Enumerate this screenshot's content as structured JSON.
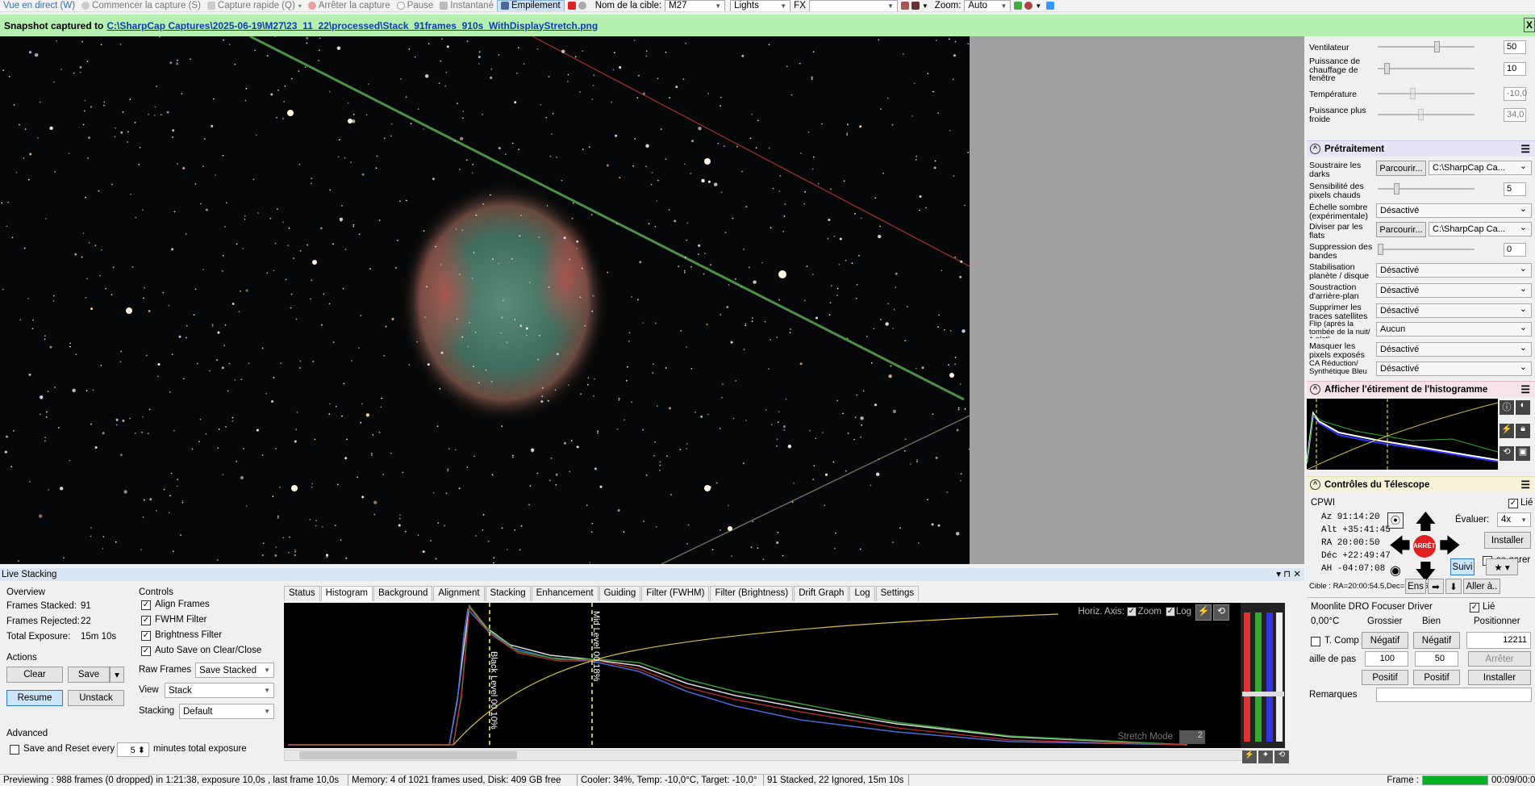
{
  "toolbar": {
    "live": "Vue en direct (W)",
    "start_capture": "Commencer la capture (S)",
    "quick_capture": "Capture rapide (Q)",
    "stop_capture": "Arrêter la capture",
    "pause": "Pause",
    "snapshot": "Instantané",
    "stacking": "Empilement",
    "target_label": "Nom de la cible:",
    "target_value": "M27",
    "frame_type": "Lights",
    "fx_label": "FX",
    "zoom_label": "Zoom:",
    "zoom_value": "Auto"
  },
  "snapshot": {
    "prefix": "Snapshot captured to",
    "path": "C:\\SharpCap Captures\\2025-06-19\\M27\\23_11_22\\processed\\Stack_91frames_910s_WithDisplayStretch.png",
    "close": "X"
  },
  "live_stacking": {
    "title": "Live Stacking",
    "overview_title": "Overview",
    "frames_stacked_label": "Frames Stacked:",
    "frames_stacked": "91",
    "frames_rejected_label": "Frames Rejected:",
    "frames_rejected": "22",
    "total_exposure_label": "Total Exposure:",
    "total_exposure": "15m 10s",
    "actions_title": "Actions",
    "clear": "Clear",
    "save": "Save",
    "resume": "Resume",
    "unstack": "Unstack",
    "controls_title": "Controls",
    "align": "Align Frames",
    "fwhm": "FWHM Filter",
    "brightness": "Brightness Filter",
    "autosave": "Auto Save on Clear/Close",
    "raw_frames_label": "Raw Frames",
    "raw_frames_value": "Save Stacked",
    "view_label": "View",
    "view_value": "Stack",
    "stacking_label": "Stacking",
    "stacking_value": "Default",
    "advanced_title": "Advanced",
    "save_reset_label": "Save and Reset every",
    "save_reset_value": "5",
    "save_reset_suffix": "minutes total exposure",
    "tabs": [
      "Status",
      "Histogram",
      "Background",
      "Alignment",
      "Stacking",
      "Enhancement",
      "Guiding",
      "Filter (FWHM)",
      "Filter (Brightness)",
      "Drift Graph",
      "Log",
      "Settings"
    ],
    "active_tab": "Histogram",
    "horiz_axis_label": "Horiz. Axis:",
    "zoom_label": "Zoom",
    "log_label": "Log",
    "black_level": "Black Level 00.10%",
    "mid_level": "Mid Level 00.18%",
    "stretch_mode": "Stretch Mode",
    "stretch_value": "2"
  },
  "status_bar": {
    "preview": "Previewing : 988 frames (0 dropped) in 1:21:38, exposure 10,0s , last frame 10,0s",
    "memory": "Memory: 4 of 1021 frames used, Disk: 409 GB free",
    "cooler": "Cooler: 34%, Temp: -10,0°C, Target: -10,0°",
    "stack": "91 Stacked, 22 Ignored, 15m 10s",
    "frame_label": "Frame :",
    "time": "00:09/00:0",
    "frame_progress": 1.0
  },
  "right_panel": {
    "fan_label": "Ventilateur",
    "fan_value": "50",
    "heater_label": "Puissance de chauffage de fenêtre",
    "heater_value": "10",
    "temp_label": "Température",
    "temp_value": "-10,0",
    "cooler_label": "Puissance plus froide",
    "cooler_value": "34,0",
    "preproc_title": "Prétraitement",
    "darks_label": "Soustraire les darks",
    "browse": "Parcourir...",
    "darks_path": "C:\\SharpCap Ca...",
    "hotpix_label": "Sensibilité des pixels chauds",
    "hotpix_value": "5",
    "dark_scale_label": "Échelle sombre (expérimentale)",
    "dark_scale_value": "Désactivé",
    "flats_label": "Diviser par les flats",
    "flats_path": "C:\\SharpCap Ca...",
    "banding_label": "Suppression des bandes",
    "banding_value": "0",
    "stab_label": "Stabilisation planète / disque",
    "stab_value": "Désactivé",
    "bg_label": "Soustraction d'arrière-plan",
    "bg_value": "Désactivé",
    "sat_label": "Supprimer les traces satellites",
    "sat_value": "Désactivé",
    "flip_label": "Flip (après la tombée de la nuit/à plat)",
    "flip_value": "Aucun",
    "mask_label": "Masquer les pixels exposés",
    "mask_value": "Désactivé",
    "ca_label": "CA Réduction/ Synthétique Bleu",
    "ca_value": "Désactivé",
    "hist_title": "Afficher l'étirement de l'histogramme",
    "tel_title": "Contrôles du Télescope",
    "mount": "CPWI",
    "linked": "Lié",
    "az": "Az    91:14:20",
    "alt": "Alt  +35:41:45",
    "ra": "RA    20:00:50",
    "dec": "Déc  +22:49:47",
    "ah": "AH   -04:07:08",
    "stop": "ARRÊTE",
    "rate_label": "Évaluer:",
    "rate_value": "4x",
    "install": "Installer",
    "park": "se garer",
    "track": "Suivi",
    "target_line": "Cible : RA=20:00:54.5,Dec=+22:46:59",
    "ens": "Ens",
    "goto": "Aller à..",
    "focuser_title": "Moonlite DRO Focuser Driver",
    "focuser_linked": "Lié",
    "temp": "0,00°C",
    "coarse": "Grossier",
    "fine": "Bien",
    "position": "Positionner",
    "tcomp": "T. Comp",
    "neg": "Négatif",
    "pos_value": "12211",
    "step_label": "aille de pas",
    "coarse_step": "100",
    "fine_step": "50",
    "stop_f": "Arrêter",
    "positive": "Positif",
    "install2": "Installer",
    "remarks": "Remarques"
  }
}
